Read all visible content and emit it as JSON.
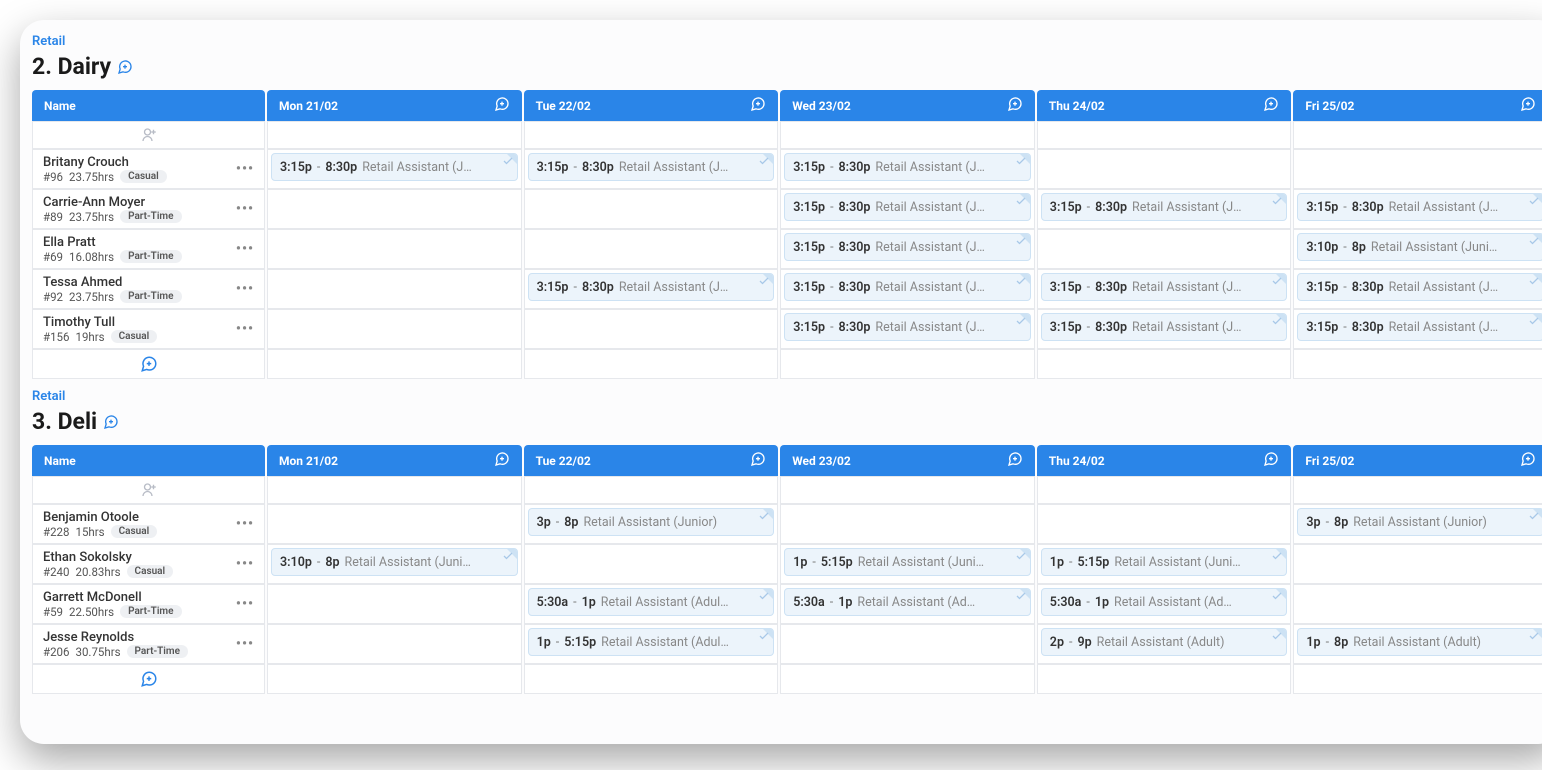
{
  "header": {
    "nameCol": "Name"
  },
  "days": [
    "Mon 21/02",
    "Tue 22/02",
    "Wed 23/02",
    "Thu 24/02",
    "Fri 25/02"
  ],
  "sections": [
    {
      "category": "Retail",
      "title": "2. Dairy",
      "employees": [
        {
          "name": "Britany Crouch",
          "id": "#96",
          "hours": "23.75hrs",
          "tagType": "Casual",
          "shifts": [
            {
              "start": "3:15p",
              "end": "8:30p",
              "role": "Retail Assistant (J…"
            },
            {
              "start": "3:15p",
              "end": "8:30p",
              "role": "Retail Assistant (J…"
            },
            {
              "start": "3:15p",
              "end": "8:30p",
              "role": "Retail Assistant (J…"
            },
            null,
            null
          ]
        },
        {
          "name": "Carrie-Ann Moyer",
          "id": "#89",
          "hours": "23.75hrs",
          "tagType": "Part-Time",
          "shifts": [
            null,
            null,
            {
              "start": "3:15p",
              "end": "8:30p",
              "role": "Retail Assistant (J…"
            },
            {
              "start": "3:15p",
              "end": "8:30p",
              "role": "Retail Assistant (J…"
            },
            {
              "start": "3:15p",
              "end": "8:30p",
              "role": "Retail Assistant (J…"
            }
          ]
        },
        {
          "name": "Ella Pratt",
          "id": "#69",
          "hours": "16.08hrs",
          "tagType": "Part-Time",
          "shifts": [
            null,
            null,
            {
              "start": "3:15p",
              "end": "8:30p",
              "role": "Retail Assistant (J…"
            },
            null,
            {
              "start": "3:10p",
              "end": "8p",
              "role": "Retail Assistant (Juni…"
            }
          ]
        },
        {
          "name": "Tessa Ahmed",
          "id": "#92",
          "hours": "23.75hrs",
          "tagType": "Part-Time",
          "shifts": [
            null,
            {
              "start": "3:15p",
              "end": "8:30p",
              "role": "Retail Assistant (J…"
            },
            {
              "start": "3:15p",
              "end": "8:30p",
              "role": "Retail Assistant (J…"
            },
            {
              "start": "3:15p",
              "end": "8:30p",
              "role": "Retail Assistant (J…"
            },
            {
              "start": "3:15p",
              "end": "8:30p",
              "role": "Retail Assistant (J…"
            }
          ]
        },
        {
          "name": "Timothy Tull",
          "id": "#156",
          "hours": "19hrs",
          "tagType": "Casual",
          "shifts": [
            null,
            null,
            {
              "start": "3:15p",
              "end": "8:30p",
              "role": "Retail Assistant (J…"
            },
            {
              "start": "3:15p",
              "end": "8:30p",
              "role": "Retail Assistant (J…"
            },
            {
              "start": "3:15p",
              "end": "8:30p",
              "role": "Retail Assistant (J…"
            }
          ]
        }
      ]
    },
    {
      "category": "Retail",
      "title": "3. Deli",
      "employees": [
        {
          "name": "Benjamin Otoole",
          "id": "#228",
          "hours": "15hrs",
          "tagType": "Casual",
          "shifts": [
            null,
            {
              "start": "3p",
              "end": "8p",
              "role": "Retail Assistant (Junior)"
            },
            null,
            null,
            {
              "start": "3p",
              "end": "8p",
              "role": "Retail Assistant (Junior)"
            }
          ]
        },
        {
          "name": "Ethan Sokolsky",
          "id": "#240",
          "hours": "20.83hrs",
          "tagType": "Casual",
          "shifts": [
            {
              "start": "3:10p",
              "end": "8p",
              "role": "Retail Assistant (Juni…"
            },
            null,
            {
              "start": "1p",
              "end": "5:15p",
              "role": "Retail Assistant (Juni…"
            },
            {
              "start": "1p",
              "end": "5:15p",
              "role": "Retail Assistant (Juni…"
            },
            null
          ]
        },
        {
          "name": "Garrett McDonell",
          "id": "#59",
          "hours": "22.50hrs",
          "tagType": "Part-Time",
          "shifts": [
            null,
            {
              "start": "5:30a",
              "end": "1p",
              "role": "Retail Assistant (Adul…"
            },
            {
              "start": "5:30a",
              "end": "1p",
              "role": "Retail Assistant (Ad…"
            },
            {
              "start": "5:30a",
              "end": "1p",
              "role": "Retail Assistant (Ad…"
            },
            null
          ]
        },
        {
          "name": "Jesse Reynolds",
          "id": "#206",
          "hours": "30.75hrs",
          "tagType": "Part-Time",
          "shifts": [
            null,
            {
              "start": "1p",
              "end": "5:15p",
              "role": "Retail Assistant (Adul…"
            },
            null,
            {
              "start": "2p",
              "end": "9p",
              "role": "Retail Assistant (Adult)"
            },
            {
              "start": "1p",
              "end": "8p",
              "role": "Retail Assistant (Adult)"
            }
          ]
        }
      ]
    }
  ]
}
